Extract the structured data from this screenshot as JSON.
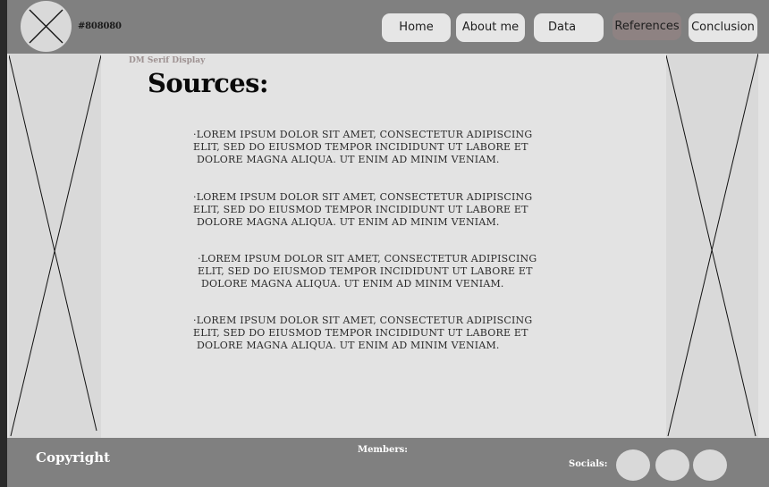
{
  "header": {
    "color_code": "#808080",
    "nav": {
      "home": "Home",
      "about": "About me",
      "data": "Data",
      "references": "References",
      "conclusion": "Conclusion"
    }
  },
  "main": {
    "font_label": "DM Serif Display",
    "title": "Sources:",
    "sources": [
      {
        "lines": [
          "·Lorem ipsum dolor sit amet, consectetur adipiscing",
          "elit, sed do eiusmod tempor incididunt ut labore et",
          "dolore magna aliqua. Ut enim ad minim veniam."
        ]
      },
      {
        "lines": [
          "·Lorem ipsum dolor sit amet, consectetur adipiscing",
          "elit, sed do eiusmod tempor incididunt ut labore et",
          "dolore magna aliqua. Ut enim ad minim veniam."
        ]
      },
      {
        "lines": [
          "·Lorem ipsum dolor sit amet, consectetur adipiscing",
          "elit, sed do eiusmod tempor incididunt ut labore et",
          "dolore magna aliqua. Ut enim ad minim veniam."
        ]
      },
      {
        "lines": [
          "·Lorem ipsum dolor sit amet, consectetur adipiscing",
          "elit, sed do eiusmod tempor incididunt ut labore et",
          "dolore magna aliqua. Ut enim ad minim veniam."
        ]
      }
    ]
  },
  "footer": {
    "copyright": "Copyright",
    "members": "Members:",
    "socials": "Socials:"
  },
  "colors": {
    "bar": "#808080",
    "page": "#e3e3e3",
    "placeholder": "#d9d9d9",
    "active_nav": "#8e8282",
    "nav_button": "#e6e6e6"
  },
  "icons": {
    "logo": "crossed-circle-placeholder",
    "side_images": "crossed-rectangle-placeholder",
    "socials": "circle-placeholder"
  }
}
